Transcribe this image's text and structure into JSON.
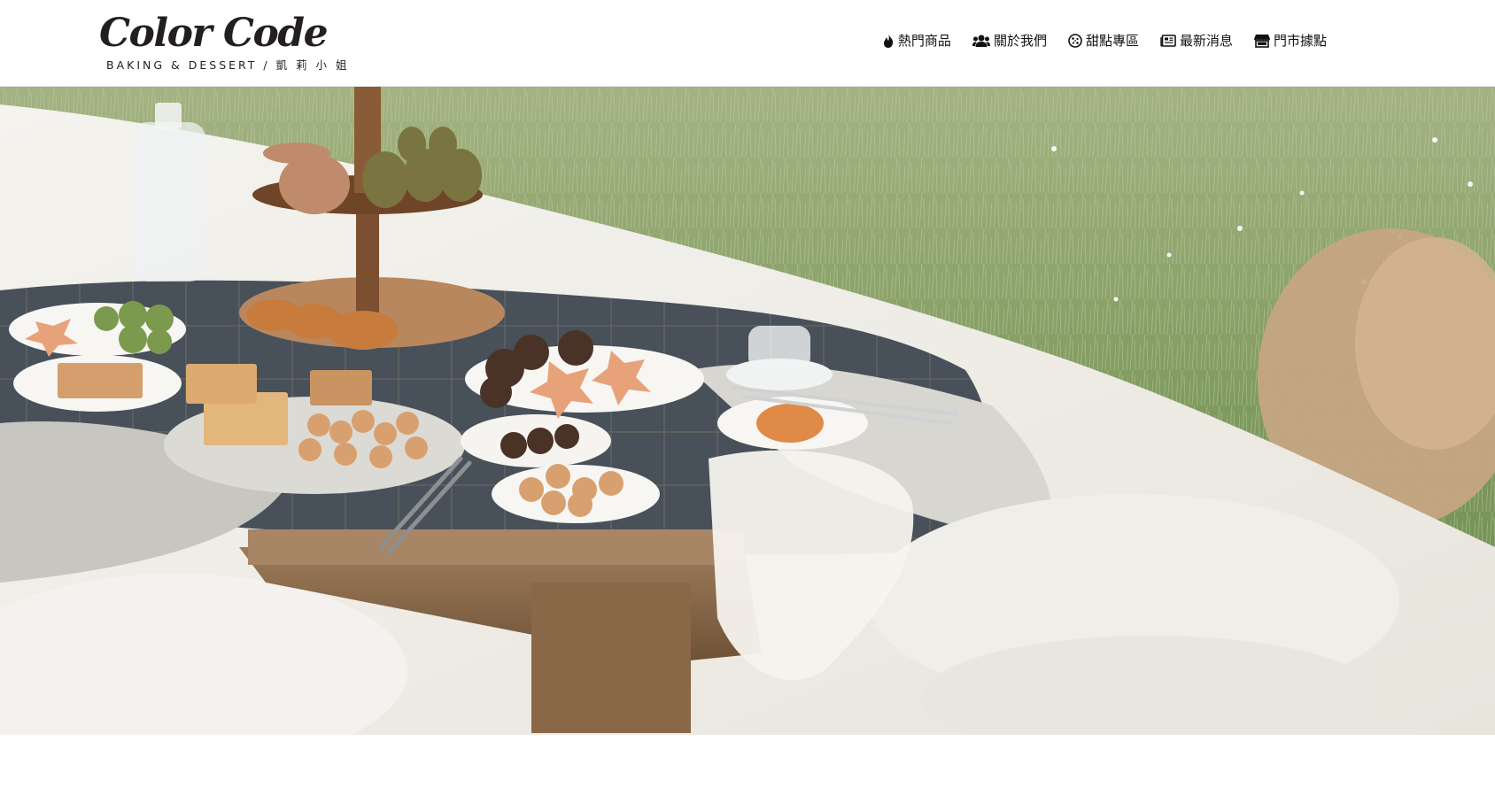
{
  "logo": {
    "main": "Color Code",
    "sub": "BAKING & DESSERT / 凱 莉 小 姐"
  },
  "nav": {
    "items": [
      {
        "label": "熱門商品",
        "icon": "fire-icon"
      },
      {
        "label": "關於我們",
        "icon": "users-icon"
      },
      {
        "label": "甜點專區",
        "icon": "cookie-icon"
      },
      {
        "label": "最新消息",
        "icon": "newspaper-icon"
      },
      {
        "label": "門市據點",
        "icon": "store-icon"
      }
    ]
  },
  "hero": {
    "image": "picnic-desserts-banner",
    "colors": {
      "grass": "#8fa36a",
      "blanket": "#f2f0ea",
      "plaid": "#3e4650",
      "wood": "#8a6a4c"
    }
  }
}
